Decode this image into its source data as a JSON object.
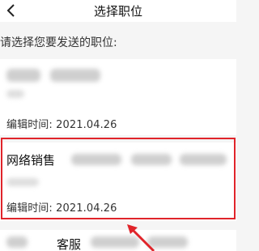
{
  "header": {
    "back_icon": "chevron-left-icon",
    "title": "选择职位"
  },
  "prompt": "请选择您要发送的职位:",
  "positions": [
    {
      "name": "",
      "edit_time": "编辑时间: 2021.04.26",
      "selected": false
    },
    {
      "name": "网络销售",
      "edit_time": "编辑时间: 2021.04.26",
      "selected": true
    },
    {
      "name": "客服",
      "edit_time": "",
      "selected": false
    }
  ],
  "annotation": {
    "highlight_color": "#e0242a",
    "arrow_icon": "red-arrow-icon"
  }
}
